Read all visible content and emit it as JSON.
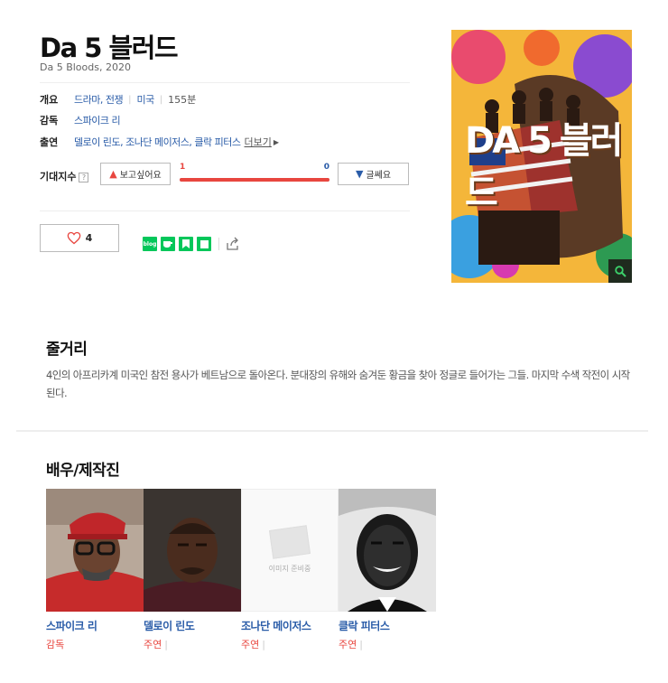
{
  "movie": {
    "title": "Da 5 블러드",
    "subtitle": "Da 5 Bloods, 2020"
  },
  "info": {
    "overview_label": "개요",
    "genre": "드라마, 전쟁",
    "country": "미국",
    "runtime": "155분",
    "director_label": "감독",
    "director": "스파이크 리",
    "cast_label": "출연",
    "cast": "델로이 린도, 조나단 메이저스, 클락 피터스",
    "more_link": "더보기"
  },
  "expect": {
    "label": "기대지수",
    "help": "?",
    "want_label": "보고싶어요",
    "want_count": "1",
    "meh_count": "0",
    "meh_label": "글쎄요",
    "want_ratio": 1.0
  },
  "like": {
    "count": "4"
  },
  "share": {
    "icons": [
      "blog-icon",
      "cafe-icon",
      "bookmark-icon",
      "memo-icon",
      "share-out-icon"
    ],
    "blog_text": "blog"
  },
  "poster": {
    "title": "DA 5 블러드"
  },
  "synopsis": {
    "heading": "줄거리",
    "text": "4인의 아프리카계 미국인 참전 용사가 베트남으로 돌아온다. 분대장의 유해와 숨겨둔 황금을 찾아 정글로 들어가는 그들. 마지막 수색 작전이 시작된다."
  },
  "crew": {
    "heading": "배우/제작진",
    "placeholder_text": "이미지 준비중",
    "members": [
      {
        "name": "스파이크 리",
        "role": "감독"
      },
      {
        "name": "델로이 린도",
        "role": "주연"
      },
      {
        "name": "조나단 메이저스",
        "role": "주연"
      },
      {
        "name": "클락 피터스",
        "role": "주연"
      }
    ]
  },
  "colors": {
    "accent_red": "#e8463f",
    "link_blue": "#2a5ca8",
    "naver_green": "#03c75a"
  }
}
